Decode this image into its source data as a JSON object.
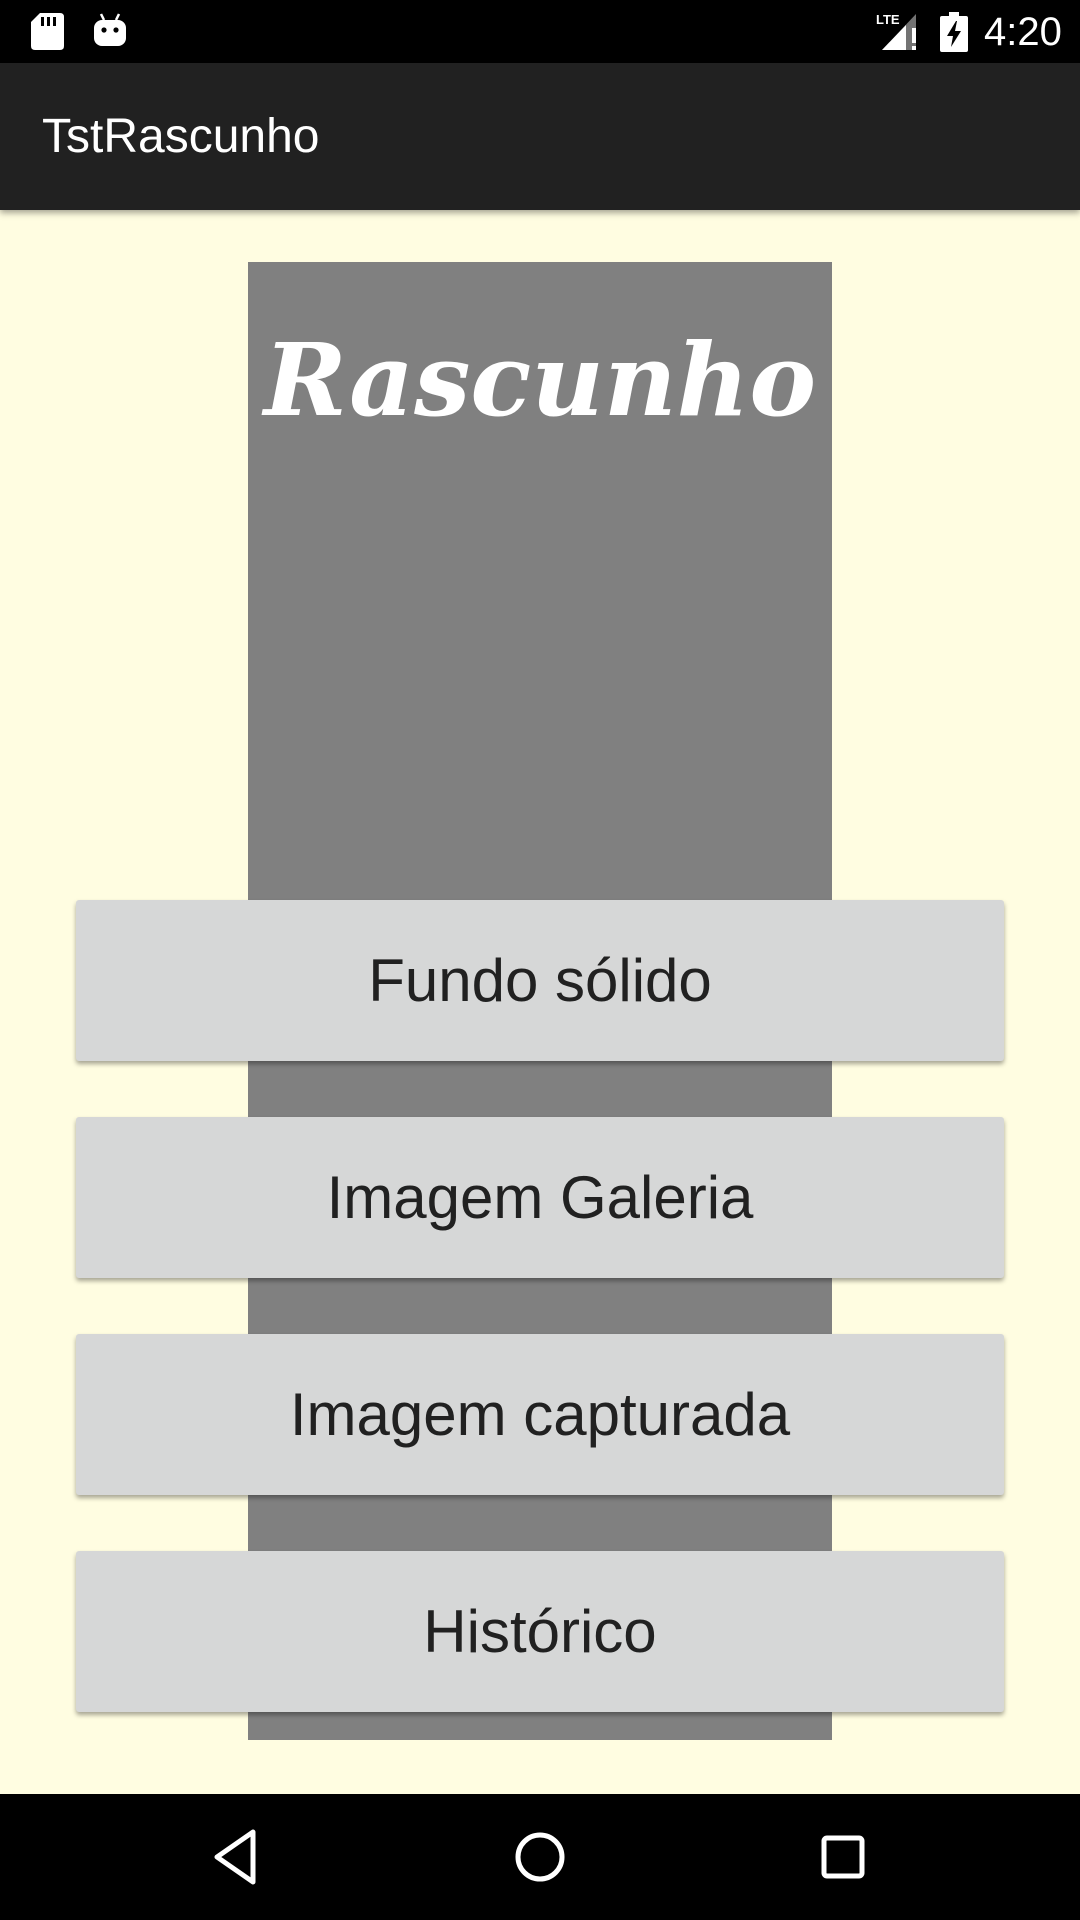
{
  "status_bar": {
    "time": "4:20",
    "network_label": "LTE",
    "icons": [
      "sd-card-icon",
      "android-debug-icon",
      "lte-signal-icon",
      "battery-charging-icon"
    ]
  },
  "app_bar": {
    "title": "TstRascunho"
  },
  "main": {
    "preview_title": "Rascunho",
    "preview_bg_color": "#808080",
    "background_color": "#FFFDE1",
    "buttons": [
      {
        "label": "Fundo sólido"
      },
      {
        "label": "Imagem Galeria"
      },
      {
        "label": "Imagem capturada"
      },
      {
        "label": "Histórico"
      }
    ]
  },
  "nav_bar": {
    "icons": [
      "back-icon",
      "home-icon",
      "recents-icon"
    ]
  }
}
